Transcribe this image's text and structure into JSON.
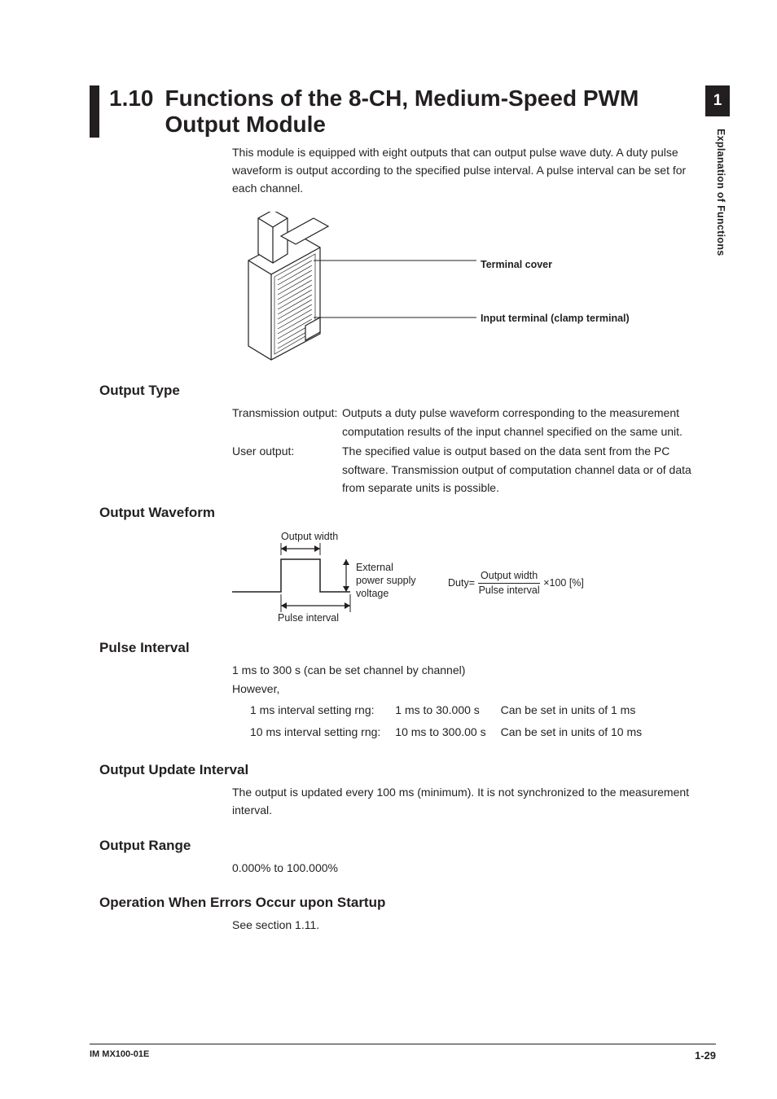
{
  "sideTab": "1",
  "sideLabel": "Explanation of Functions",
  "heading": {
    "number": "1.10",
    "title": "Functions of the 8-CH, Medium-Speed PWM Output Module"
  },
  "intro": "This module is equipped with eight outputs that can output pulse wave duty. A duty pulse waveform is output according to the specified pulse interval. A pulse interval can be set for each channel.",
  "illustration": {
    "label1": "Terminal cover",
    "label2": "Input terminal (clamp terminal)"
  },
  "outputType": {
    "heading": "Output Type",
    "rows": [
      {
        "term": "Transmission output:",
        "body": "Outputs a duty pulse waveform corresponding to the measurement computation results of the input channel specified on the same unit."
      },
      {
        "term": "User output:",
        "body": "The specified value is output based on the data sent from the PC software. Transmission output of computation channel data or of data from separate units is possible."
      }
    ]
  },
  "outputWaveform": {
    "heading": "Output Waveform",
    "labels": {
      "outputWidth": "Output width",
      "external": "External power supply voltage",
      "pulseInterval": "Pulse interval",
      "dutyPrefix": "Duty=",
      "numerator": "Output width",
      "denominator": "Pulse interval",
      "suffix": "×100 [%]"
    }
  },
  "pulseInterval": {
    "heading": "Pulse Interval",
    "line1": "1 ms to 300 s (can be set channel by channel)",
    "line2": "However,",
    "rows": [
      {
        "c1": "1 ms interval setting rng:",
        "c2": "1 ms to 30.000 s",
        "c3": "Can be set in units of 1 ms"
      },
      {
        "c1": "10 ms interval setting rng:",
        "c2": "10 ms to 300.00 s",
        "c3": "Can be set in units of 10 ms"
      }
    ]
  },
  "outputUpdate": {
    "heading": "Output Update Interval",
    "body": "The output is updated every 100 ms (minimum). It is not synchronized to the measurement interval."
  },
  "outputRange": {
    "heading": "Output Range",
    "body": "0.000% to 100.000%"
  },
  "operationErrors": {
    "heading": "Operation When Errors Occur upon Startup",
    "body": "See section 1.11."
  },
  "footer": {
    "left": "IM MX100-01E",
    "right": "1-29"
  }
}
